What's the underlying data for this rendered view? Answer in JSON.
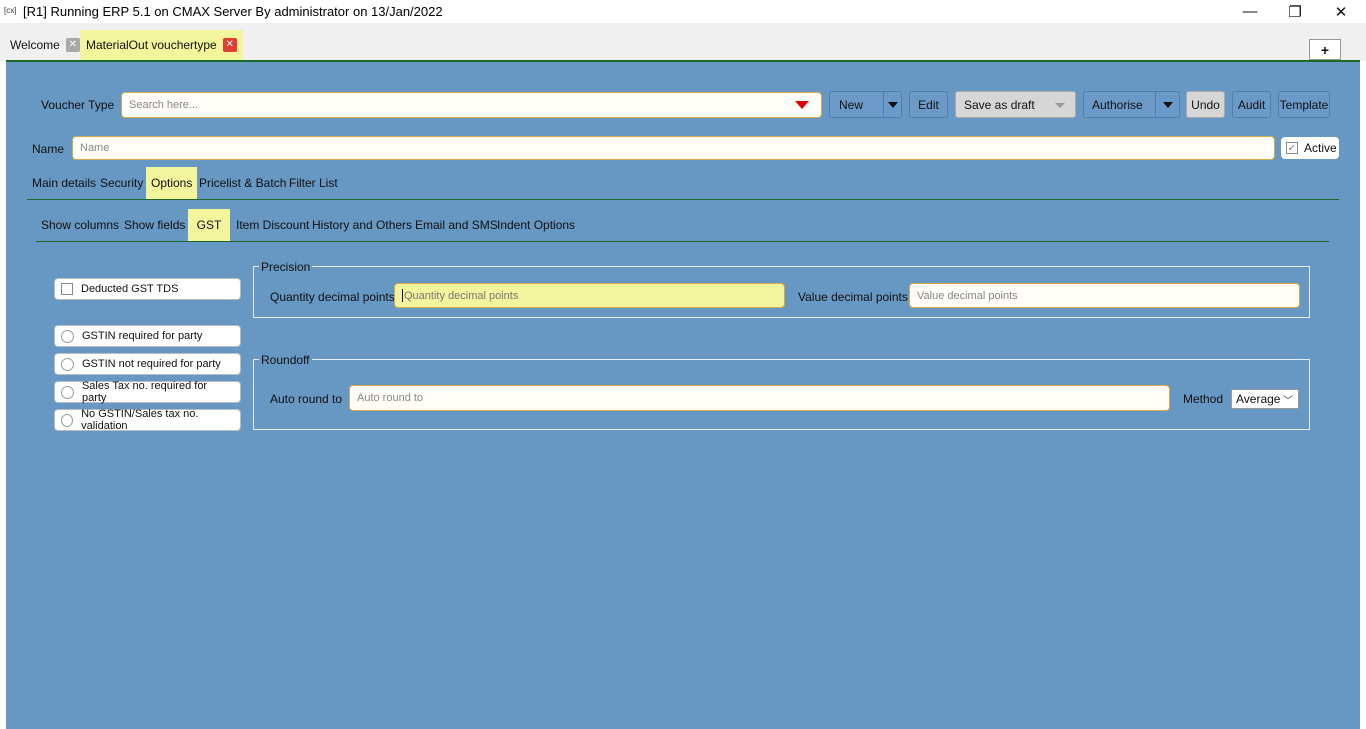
{
  "window": {
    "app_icon": "[cx]",
    "title": "[R1] Running ERP 5.1 on CMAX Server By administrator on 13/Jan/2022",
    "minimize": "—",
    "maximize": "❐",
    "close": "✕"
  },
  "tabs": [
    {
      "label": "Welcome",
      "close": "✕"
    },
    {
      "label": "MaterialOut vouchertype",
      "close": "✕"
    }
  ],
  "new_tab": "+",
  "toolbar": {
    "voucher_type_label": "Voucher Type",
    "search_placeholder": "Search here...",
    "new": "New",
    "edit": "Edit",
    "save_as_draft": "Save as draft",
    "authorise": "Authorise",
    "undo": "Undo",
    "audit": "Audit",
    "template": "Template"
  },
  "name_row": {
    "label": "Name",
    "placeholder": "Name",
    "active_label": "Active",
    "active_checked": true
  },
  "main_tabs": [
    "Main details",
    "Security",
    "Options",
    "Pricelist & Batch",
    "Filter List"
  ],
  "main_tab_active": "Options",
  "sub_tabs": [
    "Show columns",
    "Show fields",
    "GST",
    "Item Discount",
    "History and Others",
    "Email and SMS",
    "Indent Options"
  ],
  "sub_tab_active": "GST",
  "gst": {
    "deducted_tds": "Deducted GST TDS",
    "radios": [
      "GSTIN required for party",
      "GSTIN not required for party",
      "Sales Tax no. required for party",
      "No GSTIN/Sales tax no. validation"
    ]
  },
  "precision": {
    "title": "Precision",
    "qty_label": "Quantity decimal points",
    "qty_placeholder": "Quantity decimal points",
    "value_label": "Value decimal points",
    "value_placeholder": "Value decimal points"
  },
  "roundoff": {
    "title": "Roundoff",
    "auto_label": "Auto round to",
    "auto_placeholder": "Auto round to",
    "method_label": "Method",
    "method_value": "Average"
  },
  "colors": {
    "panel_bg": "#6797c3",
    "highlight": "#f2f59b",
    "divider": "#1c6a2a",
    "close_red": "#e03c31"
  }
}
